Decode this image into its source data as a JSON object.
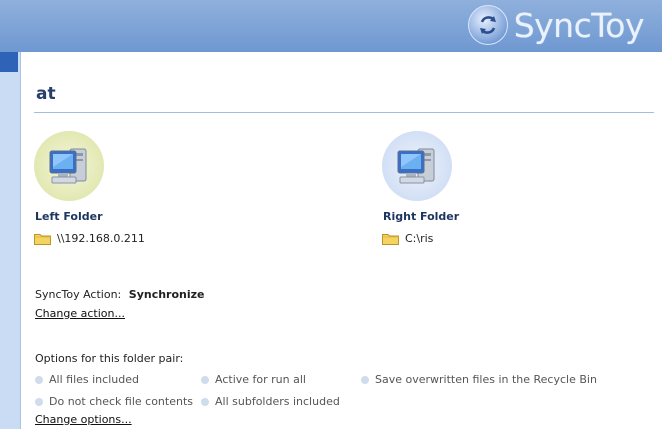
{
  "header": {
    "app_name": "SyncToy",
    "logo_icon": "synctoy-logo-icon"
  },
  "pair": {
    "name": "at"
  },
  "left_folder": {
    "label": "Left Folder",
    "path": "\\\\192.168.0.211",
    "icon": "computer-icon"
  },
  "right_folder": {
    "label": "Right Folder",
    "path": "C:\\ris",
    "icon": "computer-icon"
  },
  "action": {
    "label": "SyncToy Action:",
    "value": "Synchronize",
    "change_link": "Change action..."
  },
  "options": {
    "heading": "Options for this folder pair:",
    "items": [
      "All files included",
      "Active for run all",
      "Save overwritten files in the Recycle Bin",
      "Do not check file contents",
      "All subfolders included"
    ],
    "change_link": "Change options..."
  },
  "colors": {
    "header": "#7aa0d8",
    "title": "#27406b",
    "rail": "#c9dcf4",
    "rail_tab": "#2f63b8"
  }
}
